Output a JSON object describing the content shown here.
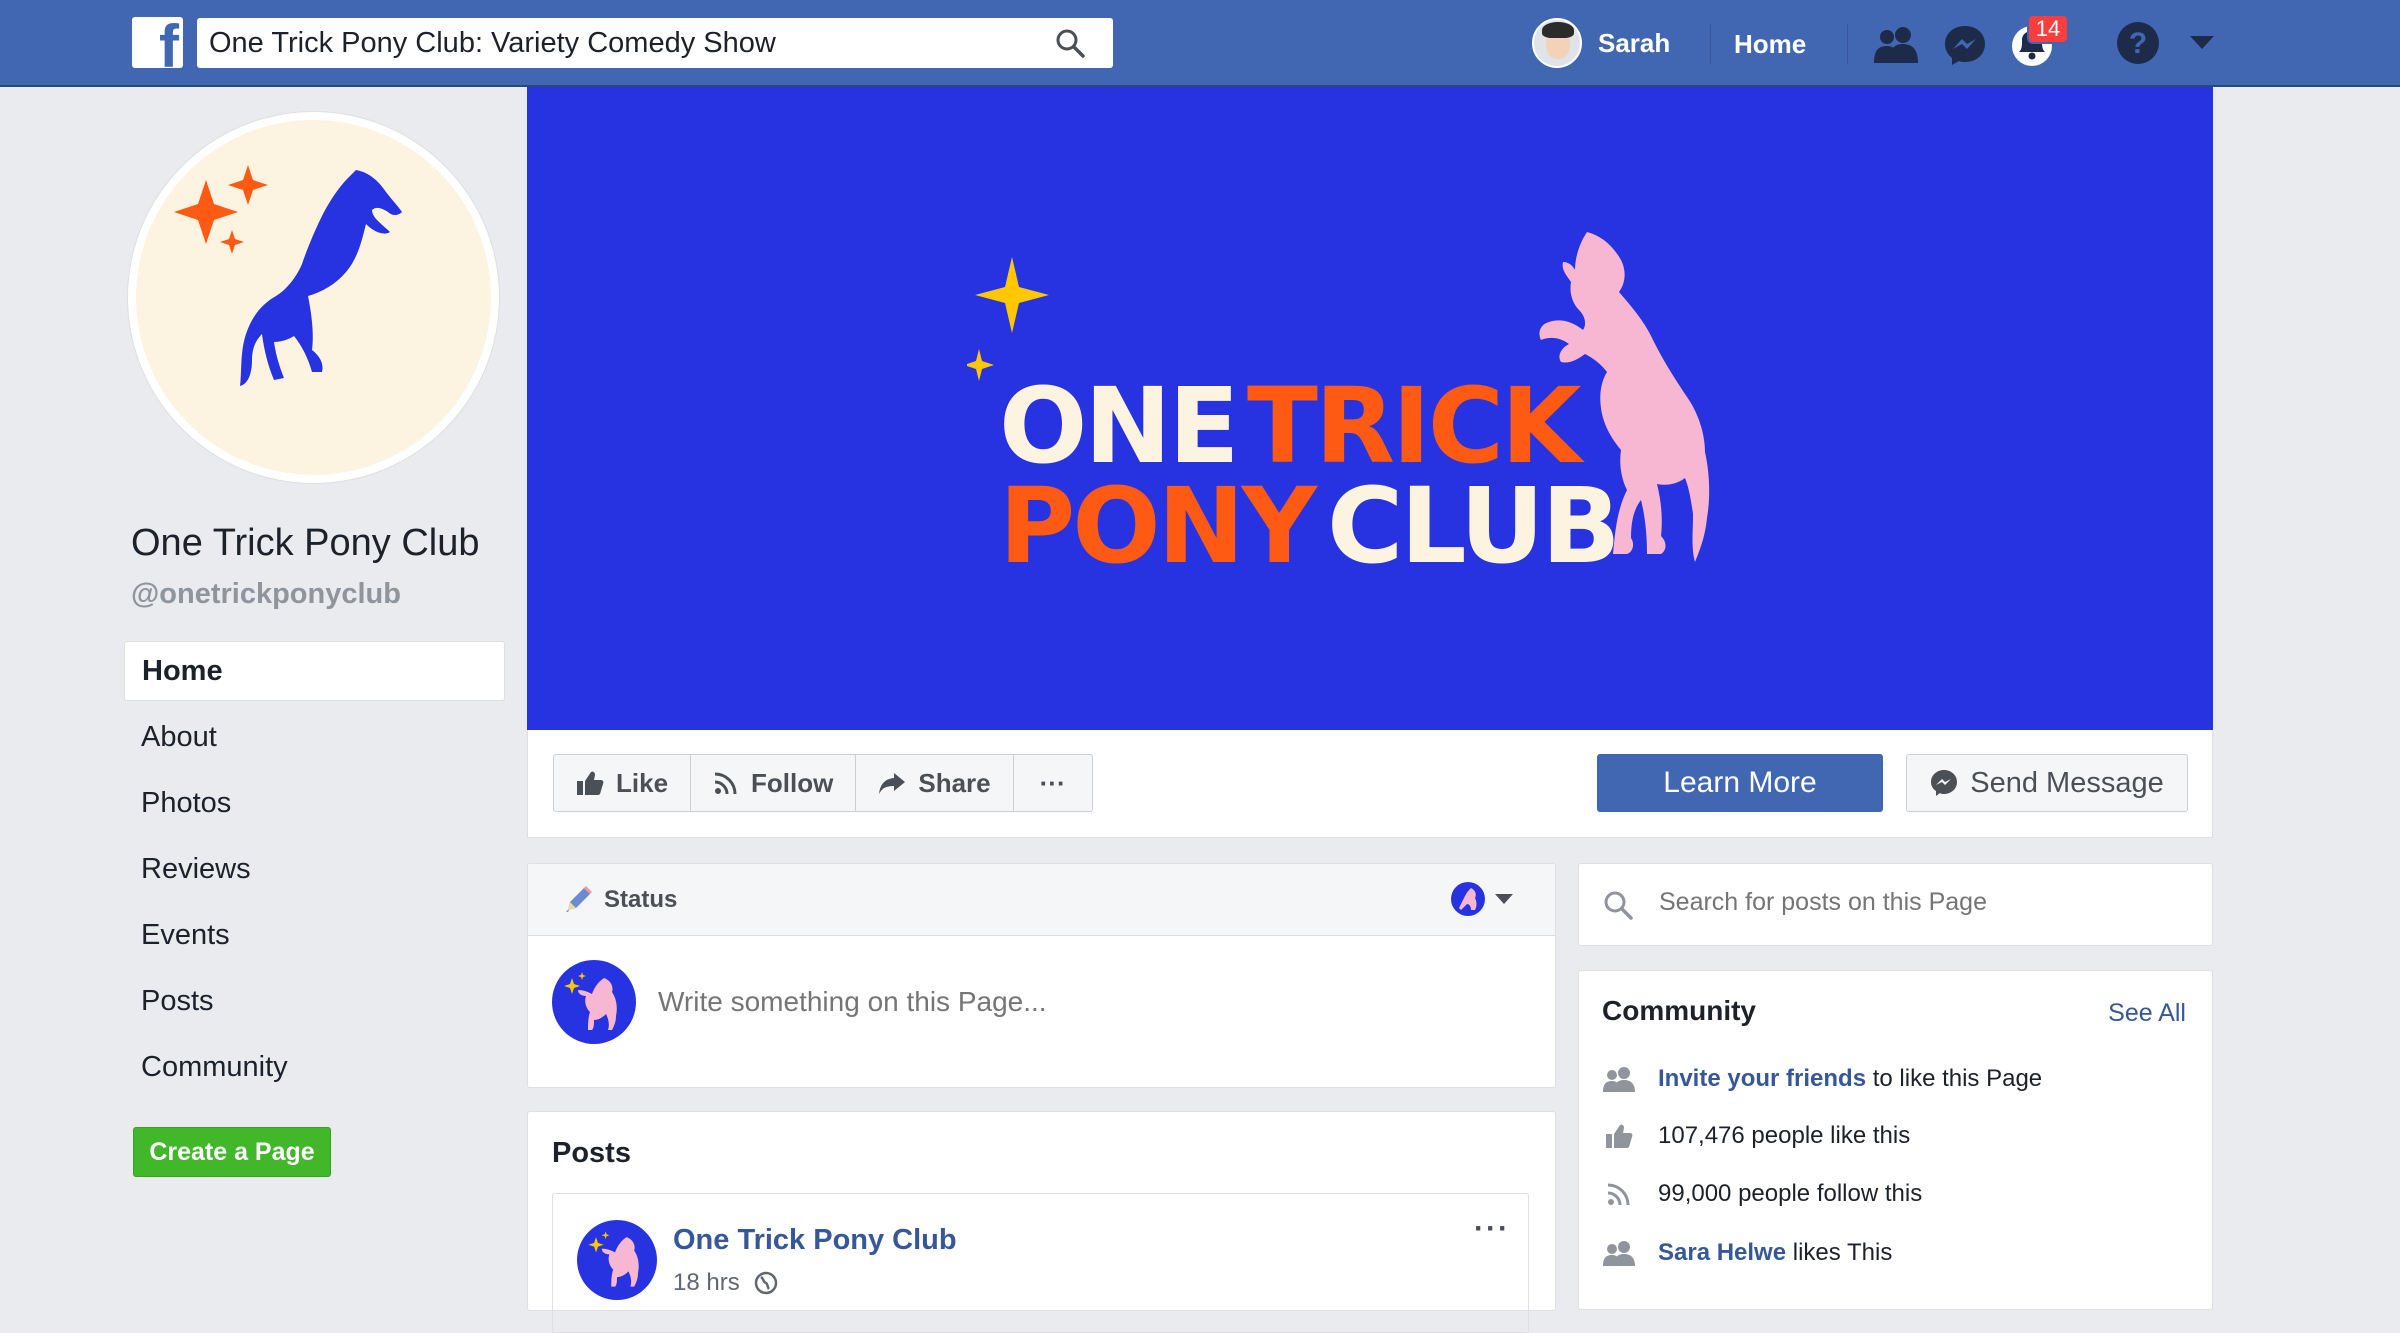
{
  "topbar": {
    "logo": "f",
    "search_value": "One Trick Pony Club: Variety Comedy Show",
    "user_name": "Sarah",
    "home_label": "Home",
    "notification_count": "14",
    "icons": [
      "friend-requests-icon",
      "messenger-icon",
      "notifications-icon",
      "help-icon",
      "account-menu-icon"
    ]
  },
  "sidebar": {
    "page_name": "One Trick Pony Club",
    "handle": "@onetrickponyclub",
    "items": [
      {
        "label": "Home",
        "active": true
      },
      {
        "label": "About"
      },
      {
        "label": "Photos"
      },
      {
        "label": "Reviews"
      },
      {
        "label": "Events"
      },
      {
        "label": "Posts"
      },
      {
        "label": "Community"
      }
    ],
    "create_page": "Create a Page"
  },
  "cover": {
    "line1_a": "ONE",
    "line1_b": "TRICK",
    "line2_a": "PONY",
    "line2_b": "CLUB",
    "colors": {
      "background": "#2733e0",
      "cream": "#fdf3e1",
      "orange": "#ff5a14",
      "pink": "#f7b6d2",
      "gold": "#ffc700"
    }
  },
  "actions": {
    "like": "Like",
    "follow": "Follow",
    "share": "Share",
    "more": "···",
    "learn_more": "Learn More",
    "send_message": "Send Message"
  },
  "status": {
    "header": "Status",
    "placeholder": "Write something on this Page..."
  },
  "posts": {
    "title": "Posts",
    "author": "One Trick Pony Club",
    "time": "18 hrs",
    "more": "···"
  },
  "right": {
    "search_placeholder": "Search for posts on this Page",
    "community_title": "Community",
    "see_all": "See All",
    "invite_link": "Invite your friends",
    "invite_rest": "to like this Page",
    "likes": "107,476 people like this",
    "follows": "99,000 people follow this",
    "friend_link": "Sara Helwe",
    "friend_rest": "likes This"
  }
}
